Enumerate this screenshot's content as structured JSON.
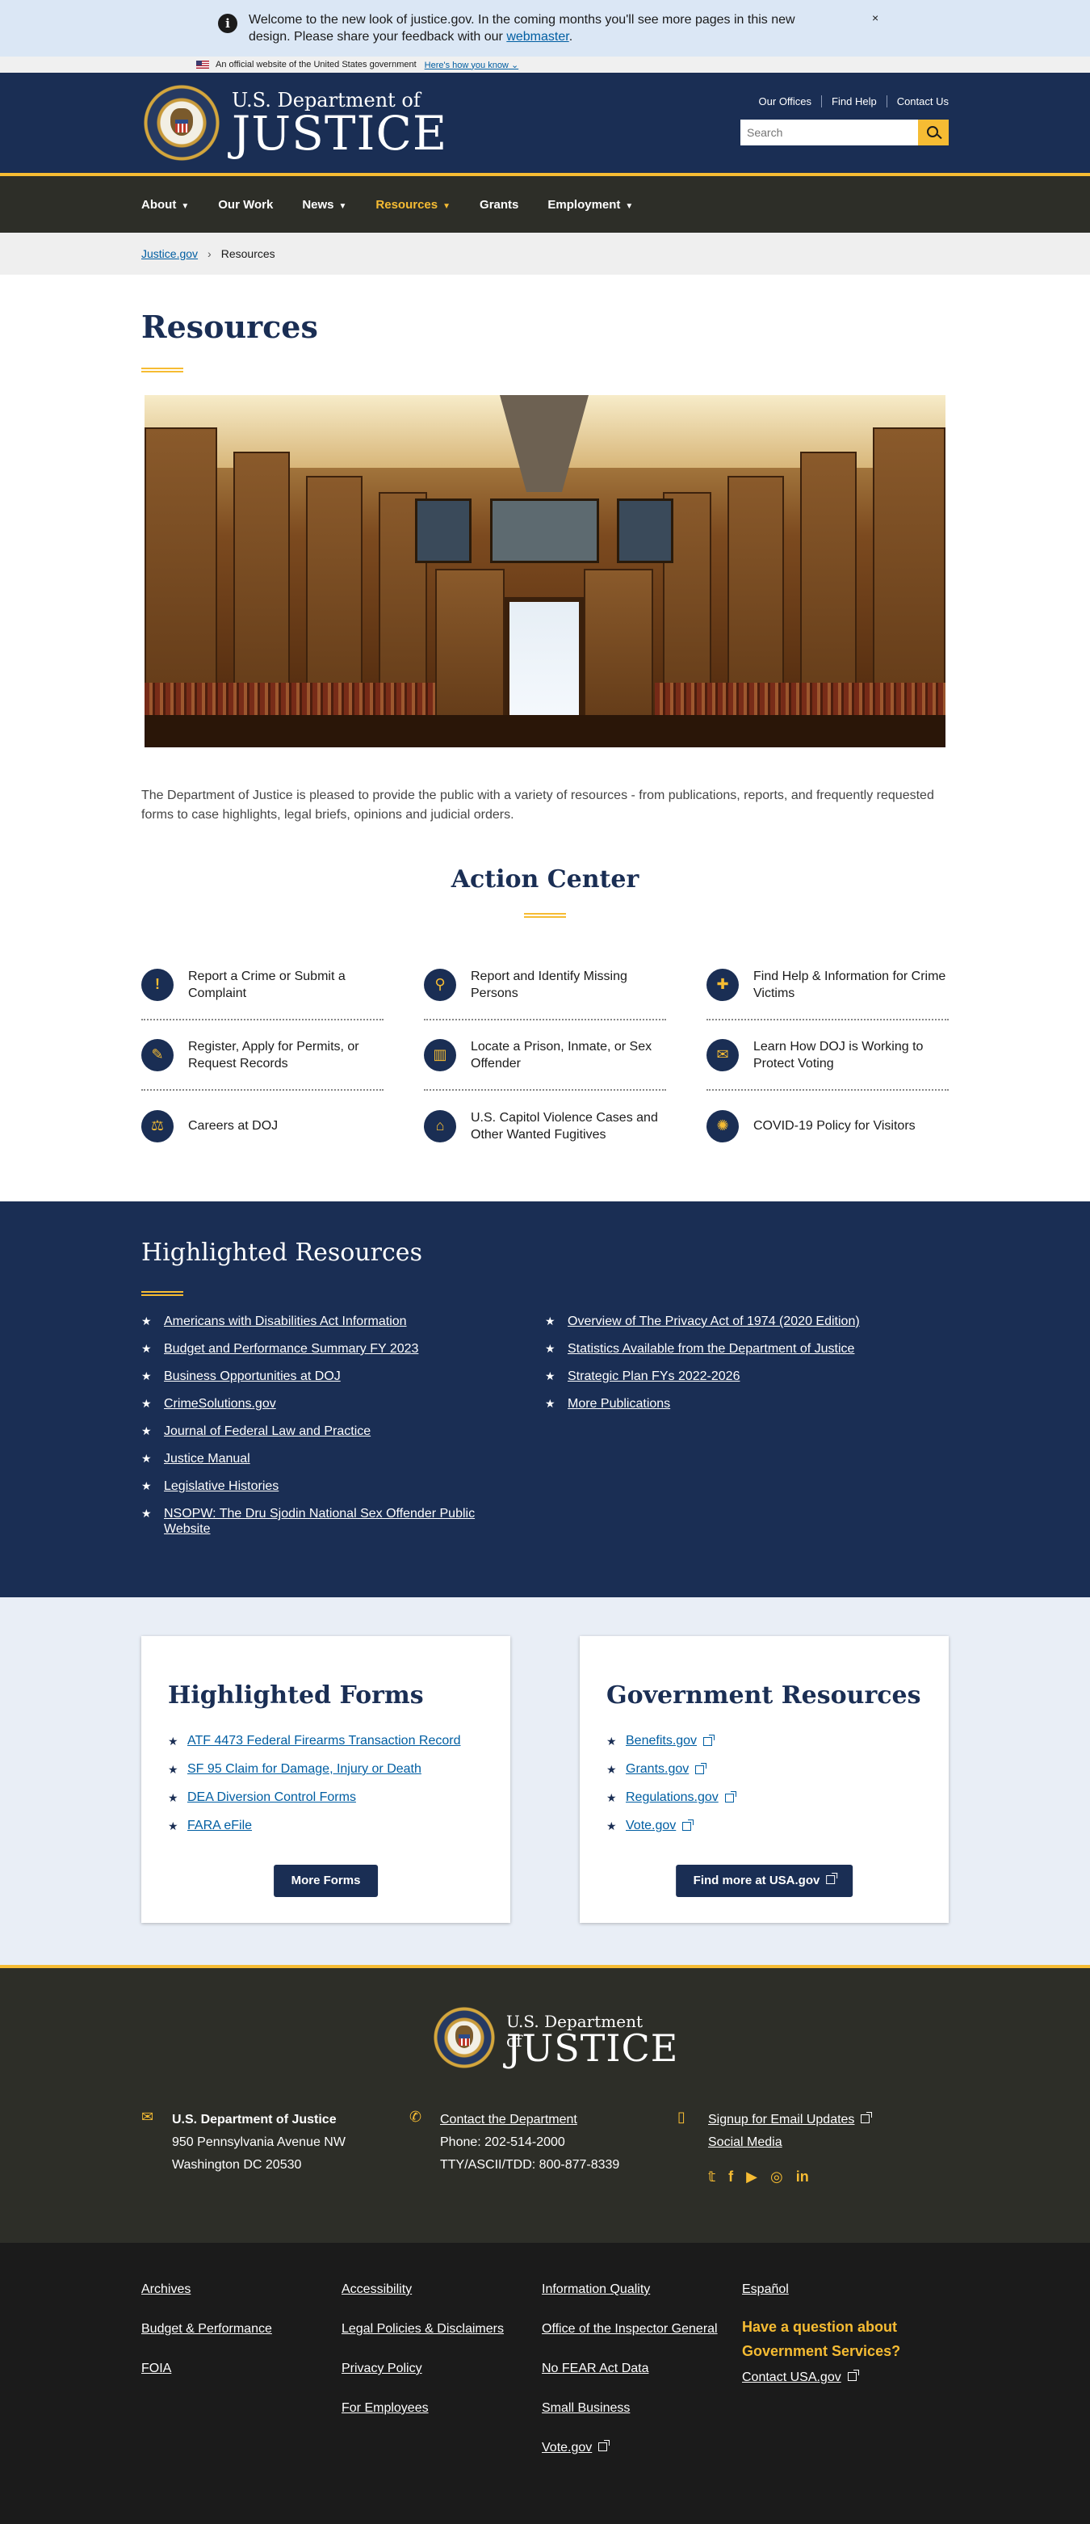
{
  "alert": {
    "message": "Welcome to the new look of justice.gov. In the coming months you'll see more pages in this new design. Please share your feedback with our",
    "link": "webmaster",
    "end": ".",
    "close": "×"
  },
  "gov_banner": {
    "text": "An official website of the United States government",
    "link": "Here's how you know"
  },
  "header": {
    "brand_sub": "U.S. Department of",
    "brand_main": "JUSTICE",
    "utility": [
      "Our Offices",
      "Find Help",
      "Contact Us"
    ],
    "search_placeholder": "Search"
  },
  "nav": {
    "items": [
      {
        "label": "About",
        "dropdown": true
      },
      {
        "label": "Our Work",
        "dropdown": false
      },
      {
        "label": "News",
        "dropdown": true
      },
      {
        "label": "Resources",
        "dropdown": true,
        "active": true
      },
      {
        "label": "Grants",
        "dropdown": false
      },
      {
        "label": "Employment",
        "dropdown": true
      }
    ]
  },
  "breadcrumb": {
    "home": "Justice.gov",
    "current": "Resources"
  },
  "page": {
    "title": "Resources",
    "intro": "The Department of Justice is pleased to provide the public with a variety of resources - from publications, reports, and frequently requested forms to case highlights, legal briefs, opinions and judicial orders."
  },
  "action_center": {
    "title": "Action Center",
    "items": [
      {
        "label": "Report a Crime or Submit a Complaint",
        "icon": "exclamation-icon",
        "glyph": "!"
      },
      {
        "label": "Report and Identify Missing Persons",
        "icon": "magnifier-person-icon",
        "glyph": "⚲"
      },
      {
        "label": "Find Help & Information for Crime Victims",
        "icon": "first-aid-icon",
        "glyph": "✚"
      },
      {
        "label": "Register, Apply for Permits, or Request Records",
        "icon": "form-pencil-icon",
        "glyph": "✎"
      },
      {
        "label": "Locate a Prison, Inmate, or Sex Offender",
        "icon": "prison-bars-icon",
        "glyph": "▥"
      },
      {
        "label": "Learn How DOJ is Working to Protect Voting",
        "icon": "ballot-box-icon",
        "glyph": "✉"
      },
      {
        "label": "Careers at DOJ",
        "icon": "scales-icon",
        "glyph": "⚖"
      },
      {
        "label": "U.S. Capitol Violence Cases and Other Wanted Fugitives",
        "icon": "capitol-icon",
        "glyph": "⌂"
      },
      {
        "label": "COVID-19 Policy for Visitors",
        "icon": "virus-icon",
        "glyph": "✺"
      }
    ]
  },
  "highlighted_resources": {
    "title": "Highlighted Resources",
    "left": [
      "Americans with Disabilities Act Information",
      "Budget and Performance Summary FY 2023",
      "Business Opportunities at DOJ",
      "CrimeSolutions.gov",
      "Journal of Federal Law and Practice",
      "Justice Manual",
      "Legislative Histories",
      "NSOPW: The Dru Sjodin National Sex Offender Public Website"
    ],
    "right": [
      "Overview of The Privacy Act of 1974 (2020 Edition)",
      "Statistics Available from the Department of Justice",
      "Strategic Plan FYs 2022-2026",
      "More Publications"
    ]
  },
  "highlighted_forms": {
    "title": "Highlighted Forms",
    "items": [
      "ATF 4473 Federal Firearms Transaction Record",
      "SF 95 Claim for Damage, Injury or Death",
      "DEA Diversion Control Forms",
      "FARA eFile"
    ],
    "button": "More Forms"
  },
  "government_resources": {
    "title": "Government Resources",
    "items": [
      "Benefits.gov",
      "Grants.gov",
      "Regulations.gov",
      "Vote.gov"
    ],
    "button": "Find more at USA.gov"
  },
  "footer": {
    "brand_sub": "U.S. Department of",
    "brand_main": "JUSTICE",
    "address": {
      "name": "U.S. Department of Justice",
      "line1": "950 Pennsylvania Avenue NW",
      "line2": "Washington DC 20530"
    },
    "contact": {
      "link": "Contact the Department",
      "phone": "Phone: 202-514-2000",
      "tty": "TTY/ASCII/TDD: 800-877-8339"
    },
    "updates": {
      "signup": "Signup for Email Updates",
      "social": "Social Media"
    },
    "social_icons": [
      "twitter-icon",
      "facebook-icon",
      "youtube-icon",
      "instagram-icon",
      "linkedin-icon"
    ]
  },
  "bottom_links": {
    "col1": [
      "Archives",
      "Budget & Performance",
      "FOIA"
    ],
    "col2": [
      "Accessibility",
      "Legal Policies & Disclaimers",
      "Privacy Policy",
      "For Employees"
    ],
    "col3": [
      "Information Quality",
      "Office of the Inspector General",
      "No FEAR Act Data",
      "Small Business",
      "Vote.gov"
    ],
    "col4_link": "Español",
    "question": "Have a question about Government Services?",
    "contact_usa": "Contact USA.gov"
  },
  "colors": {
    "navy": "#1a2e54",
    "gold": "#f6bc33",
    "footer": "#2d2e28",
    "link": "#005ea2"
  }
}
